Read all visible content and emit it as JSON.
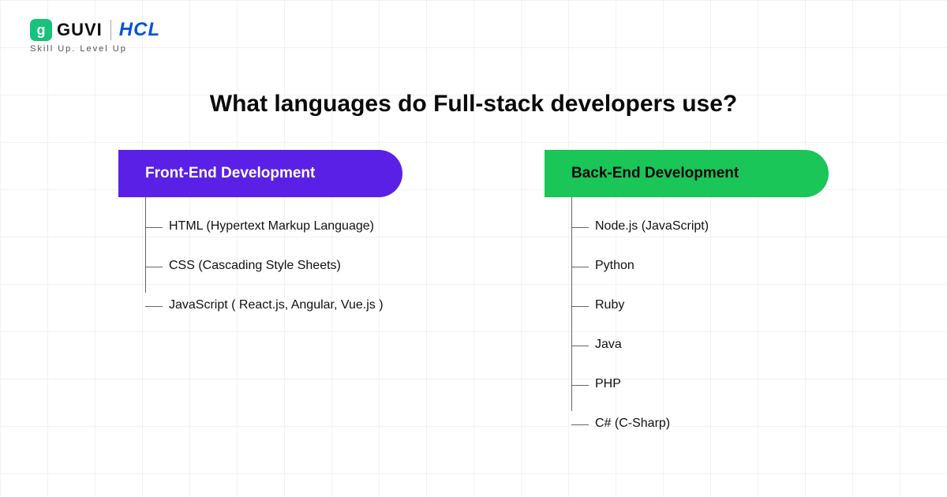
{
  "brand": {
    "guvi_mark": "g",
    "guvi_text": "GUVI",
    "partner_text": "HCL",
    "tagline": "Skill Up. Level Up"
  },
  "title": "What languages do Full-stack developers use?",
  "columns": [
    {
      "label": "Front-End Development",
      "color": "purple",
      "items": [
        "HTML (Hypertext Markup Language)",
        "CSS (Cascading Style Sheets)",
        "JavaScript ( React.js, Angular, Vue.js )"
      ]
    },
    {
      "label": "Back-End Development",
      "color": "green",
      "items": [
        "Node.js (JavaScript)",
        "Python",
        "Ruby",
        "Java",
        "PHP",
        "C# (C-Sharp)"
      ]
    }
  ]
}
